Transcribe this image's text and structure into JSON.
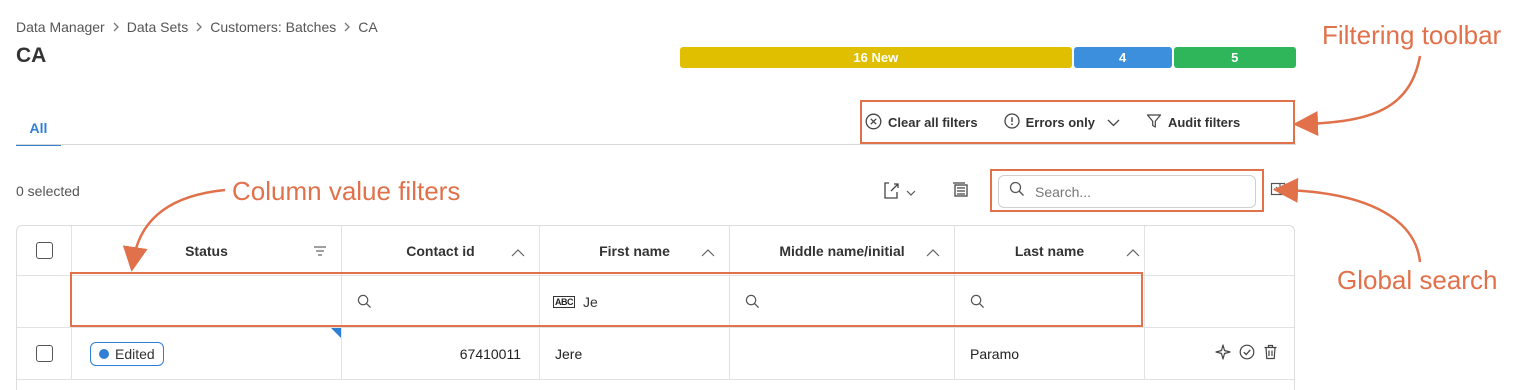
{
  "breadcrumb": [
    "Data Manager",
    "Data Sets",
    "Customers: Batches",
    "CA"
  ],
  "page_title": "CA",
  "progress": [
    {
      "label": "16 New",
      "value": 16,
      "color": "#e0be00"
    },
    {
      "label": "4",
      "value": 4,
      "color": "#3b8fdc"
    },
    {
      "label": "5",
      "value": 5,
      "color": "#2fb55a"
    }
  ],
  "tabs": [
    {
      "label": "All",
      "active": true
    }
  ],
  "filter_toolbar": {
    "clear_all": "Clear all filters",
    "errors_only": "Errors only",
    "audit_filters": "Audit filters"
  },
  "selected_count": "0 selected",
  "search": {
    "placeholder": "Search...",
    "value": ""
  },
  "table": {
    "columns": [
      "Status",
      "Contact id",
      "First name",
      "Middle name/initial",
      "Last name"
    ],
    "filters": {
      "first_name_value": "Je"
    },
    "rows": [
      {
        "status": "Edited",
        "contact_id": "67410011",
        "first_name": "Jere",
        "middle_name": "",
        "last_name": "Paramo"
      }
    ]
  },
  "annotations": {
    "filtering_toolbar": "Filtering toolbar",
    "column_value_filters": "Column value filters",
    "global_search": "Global search"
  },
  "colors": {
    "accent": "#2f7fd6",
    "annotation": "#e0714a"
  }
}
